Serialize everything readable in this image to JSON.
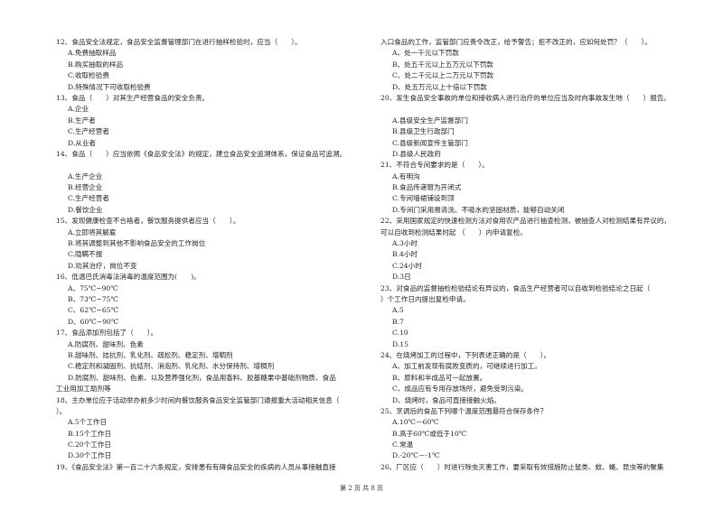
{
  "left_column": [
    {
      "t": "12、食品安全法规定，食品安全监督管理部门在进行抽样检验时，应当（　　）。",
      "k": "q"
    },
    {
      "t": "A.免费抽取样品",
      "k": "opt"
    },
    {
      "t": "B.购买抽取的样品",
      "k": "opt"
    },
    {
      "t": "C.收取检验费",
      "k": "opt"
    },
    {
      "t": "D.特殊情况下可收取检验费",
      "k": "opt"
    },
    {
      "t": "13、食品（　　）对其生产经营食品的安全负责。",
      "k": "q"
    },
    {
      "t": "A.企业",
      "k": "opt"
    },
    {
      "t": "B.生产者",
      "k": "opt"
    },
    {
      "t": "C.生产经营者",
      "k": "opt"
    },
    {
      "t": "D.从业者",
      "k": "opt"
    },
    {
      "t": "14、食品（　　）应当依照《食品安全法》的规定，建立食品安全追溯体系，保证食品可追溯。",
      "k": "q"
    },
    {
      "t": "",
      "k": "q"
    },
    {
      "t": "A.生产企业",
      "k": "opt"
    },
    {
      "t": "B.经营企业",
      "k": "opt"
    },
    {
      "t": "C.生产经营者",
      "k": "opt"
    },
    {
      "t": "D.餐饮企业",
      "k": "opt"
    },
    {
      "t": "15、发现健康检查不合格者，餐饮服务提供者应当（　　）。",
      "k": "q"
    },
    {
      "t": "A.立即将其解雇",
      "k": "opt"
    },
    {
      "t": "B.将其调整到其他不影响食品安全的工作岗位",
      "k": "opt"
    },
    {
      "t": "C.隐瞒不报",
      "k": "opt"
    },
    {
      "t": "D.劝其治疗，岗位不变",
      "k": "opt"
    },
    {
      "t": "16、低温巴氏消毒法消毒的温度范围为(　　)。",
      "k": "q"
    },
    {
      "t": "A、75℃~90℃",
      "k": "opt"
    },
    {
      "t": "B、73℃~75℃",
      "k": "opt"
    },
    {
      "t": "C、62℃~65℃",
      "k": "opt"
    },
    {
      "t": "D、60℃~90℃",
      "k": "opt"
    },
    {
      "t": "17、食品添加剂包括了（　　）。",
      "k": "q"
    },
    {
      "t": "A.防腐剂、甜味剂、色素",
      "k": "opt"
    },
    {
      "t": "B.甜味剂、拮抗剂、乳化剂、疏松剂、稳定剂、增稠剂",
      "k": "opt"
    },
    {
      "t": "C.稳定剂和凝固剂、抗结剂、消泡剂、乳化剂、水分保持剂、增稠剂",
      "k": "opt"
    },
    {
      "t": "D.防腐剂、甜味剂、色素、以及营养强化剂，食品用香料、胶基糖果中基础剂物质、食品",
      "k": "opt"
    },
    {
      "t": "工业用加工助剂等",
      "k": "q"
    },
    {
      "t": "18、主办单位应于活动举办前多少时间向餐饮服务食品安全监管部门通报重大活动相关信息（",
      "k": "q"
    },
    {
      "t": "）。",
      "k": "q"
    },
    {
      "t": "A.5个工作日",
      "k": "opt"
    },
    {
      "t": "B.15个工作日",
      "k": "opt"
    },
    {
      "t": "C.20个工作日",
      "k": "opt"
    },
    {
      "t": "D.30个工作日",
      "k": "opt"
    },
    {
      "t": "19、《食品安全法》第一百二十六条规定，安排患有有碍食品安全的疾病的人员从事接触直接",
      "k": "q"
    }
  ],
  "right_column": [
    {
      "t": "入口食品的工作，监管部门应责令改正，给予警告；拒不改正的，应如何处罚？（　　）。",
      "k": "q"
    },
    {
      "t": "A、处一千元以下罚款",
      "k": "opt"
    },
    {
      "t": "B、处五千元以上五万元以下罚款",
      "k": "opt"
    },
    {
      "t": "C、处二千元以上二万元以下罚款",
      "k": "opt"
    },
    {
      "t": "D、处五万元以上十倍以下罚款",
      "k": "opt"
    },
    {
      "t": "20、发生食品安全事故的单位和接收病人进行治疗的单位应当及时向事故发生地（　　）报告。",
      "k": "q"
    },
    {
      "t": "",
      "k": "q"
    },
    {
      "t": "A.县级安全生产监督部门",
      "k": "opt"
    },
    {
      "t": "B.县级卫生行政部门",
      "k": "opt"
    },
    {
      "t": "C.县级新闻宣传主管部门",
      "k": "opt"
    },
    {
      "t": "D.县级人民政府",
      "k": "opt"
    },
    {
      "t": "21、不符合专间要求的是（　　）。",
      "k": "q"
    },
    {
      "t": "A.有明沟",
      "k": "opt"
    },
    {
      "t": "B.食品传递窗为开闭式",
      "k": "opt"
    },
    {
      "t": "C.专间墙裙铺设到顶",
      "k": "opt"
    },
    {
      "t": "D.专间门采用易清洗、不吸水的坚固材质，能够自动关闭",
      "k": "opt"
    },
    {
      "t": "22、采用国家规定的快速检测方法对食用农产品进行抽查检测，被抽查人对检测结果有异议的，",
      "k": "q"
    },
    {
      "t": "可以自收到检测结果时起 （　　）内申请复检。",
      "k": "q"
    },
    {
      "t": "A.3小时",
      "k": "opt"
    },
    {
      "t": "B.4小时",
      "k": "opt"
    },
    {
      "t": "C.24小时",
      "k": "opt"
    },
    {
      "t": "D.3日",
      "k": "opt"
    },
    {
      "t": "23、对食品的监督抽检检验结论有异议的，食品生产经营者可以自收到检验结论之日起（",
      "k": "q"
    },
    {
      "t": "）个工作日内提出复检申请。",
      "k": "q"
    },
    {
      "t": "A.5",
      "k": "opt"
    },
    {
      "t": "B.7",
      "k": "opt"
    },
    {
      "t": "C.10",
      "k": "opt"
    },
    {
      "t": "D.15",
      "k": "opt"
    },
    {
      "t": "24、在烧烤加工的过程中，下列表述正确的是（　　）。",
      "k": "q"
    },
    {
      "t": "A、加工前发现有腐败变质的，可继续进行加工。",
      "k": "opt"
    },
    {
      "t": "B、原料和半成品可一起放置。",
      "k": "opt"
    },
    {
      "t": "C、成品应有专用存放场所，避免受到污染。",
      "k": "opt"
    },
    {
      "t": "D、烧烤时，食品可直接接触火焰。",
      "k": "opt"
    },
    {
      "t": "25、烹调后的食品下列哪个温度范围最符合保存条件？",
      "k": "q"
    },
    {
      "t": "A.10℃－60℃",
      "k": "opt"
    },
    {
      "t": "B.高于60℃或低于10℃",
      "k": "opt"
    },
    {
      "t": "C.常温",
      "k": "opt"
    },
    {
      "t": "D.-20℃－-1℃",
      "k": "opt"
    },
    {
      "t": "26、厂区应（　　）时进行除虫灭害工作，要采取有效措施防止鼠类、蚊、蝇、昆虫等的聚集",
      "k": "q"
    }
  ],
  "footer": {
    "page_label": "第 2 页 共 8 页"
  }
}
